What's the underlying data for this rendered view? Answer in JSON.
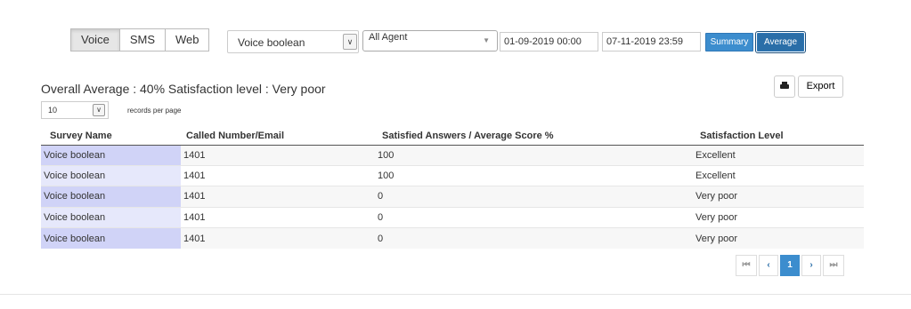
{
  "channel_tabs": [
    {
      "label": "Voice",
      "active": true
    },
    {
      "label": "SMS",
      "active": false
    },
    {
      "label": "Web",
      "active": false
    }
  ],
  "filters": {
    "survey_select": "Voice boolean",
    "agent_select": "All Agent",
    "date_from": "01-09-2019 00:00",
    "date_to": "07-11-2019 23:59",
    "summary_label": "Summary",
    "average_label": "Average"
  },
  "overall_text": "Overall Average : 40% Satisfaction level : Very poor",
  "actions": {
    "export_label": "Export"
  },
  "records_per_page": {
    "value": "10",
    "label": "records per page"
  },
  "table": {
    "headers": [
      "Survey Name",
      "Called Number/Email",
      "Satisfied Answers / Average Score %",
      "Satisfaction Level"
    ],
    "rows": [
      [
        "Voice boolean",
        "1401",
        "100",
        "Excellent"
      ],
      [
        "Voice boolean",
        "1401",
        "100",
        "Excellent"
      ],
      [
        "Voice boolean",
        "1401",
        "0",
        "Very poor"
      ],
      [
        "Voice boolean",
        "1401",
        "0",
        "Very poor"
      ],
      [
        "Voice boolean",
        "1401",
        "0",
        "Very poor"
      ]
    ]
  },
  "pagination": {
    "current_page": "1",
    "first_glyph": "⏮",
    "prev_glyph": "‹",
    "next_glyph": "›",
    "last_glyph": "⏭"
  },
  "colors": {
    "accent_blue": "#3c8dce",
    "survey_col_dark": "#d0d3f7",
    "survey_col_light": "#e6e8fb"
  }
}
